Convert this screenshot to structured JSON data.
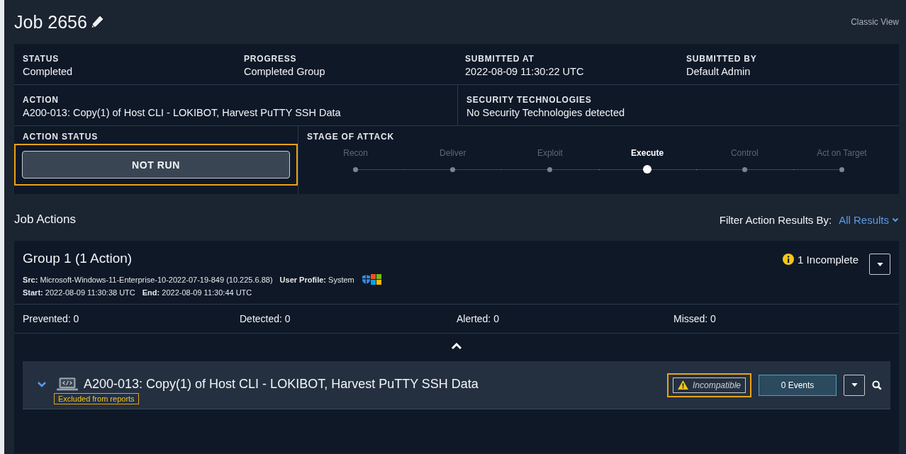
{
  "header": {
    "title": "Job 2656",
    "classic_view": "Classic View"
  },
  "summary": {
    "row1": [
      {
        "label": "STATUS",
        "value": "Completed"
      },
      {
        "label": "PROGRESS",
        "value": "Completed Group"
      },
      {
        "label": "SUBMITTED AT",
        "value": "2022-08-09 11:30:22 UTC"
      },
      {
        "label": "SUBMITTED BY",
        "value": "Default Admin"
      }
    ],
    "row2": [
      {
        "label": "ACTION",
        "value": "A200-013: Copy(1) of Host CLI - LOKIBOT, Harvest PuTTY SSH Data"
      },
      {
        "label": "SECURITY TECHNOLOGIES",
        "value": "No Security Technologies detected"
      }
    ],
    "action_status": {
      "label": "ACTION STATUS",
      "value": "NOT RUN",
      "highlighted": true
    },
    "stage_of_attack": {
      "label": "STAGE OF ATTACK",
      "stages": [
        {
          "label": "Recon",
          "selected": false
        },
        {
          "label": "Deliver",
          "selected": false
        },
        {
          "label": "Exploit",
          "selected": false
        },
        {
          "label": "Execute",
          "selected": true
        },
        {
          "label": "Control",
          "selected": false
        },
        {
          "label": "Act on Target",
          "selected": false
        }
      ]
    }
  },
  "job_actions": {
    "title": "Job Actions",
    "filter_label": "Filter Action Results By:",
    "filter_value": "All Results"
  },
  "group": {
    "title": "Group 1 (1 Action)",
    "incomplete": "1 Incomplete",
    "src_line": "**Src:** Microsoft-Windows-11-Enterprise-10-2022-07-19-849 (10.225.6.88)",
    "profile_line": "**User Profile:** System",
    "start_line": "**Start:** 2022-08-09 11:30:38 UTC",
    "end_line": "**End:** 2022-08-09 11:30:44 UTC",
    "counts": [
      "Prevented: 0",
      "Detected: 0",
      "Alerted: 0",
      "Missed: 0"
    ]
  },
  "action": {
    "title": "A200-013: Copy(1) of Host CLI - LOKIBOT, Harvest PuTTY SSH Data",
    "tag": "Excluded from reports",
    "tag_highlighted": true,
    "badge": "Incompatible",
    "badge_highlighted": true,
    "events": "0 Events",
    "expanded": false
  }
}
